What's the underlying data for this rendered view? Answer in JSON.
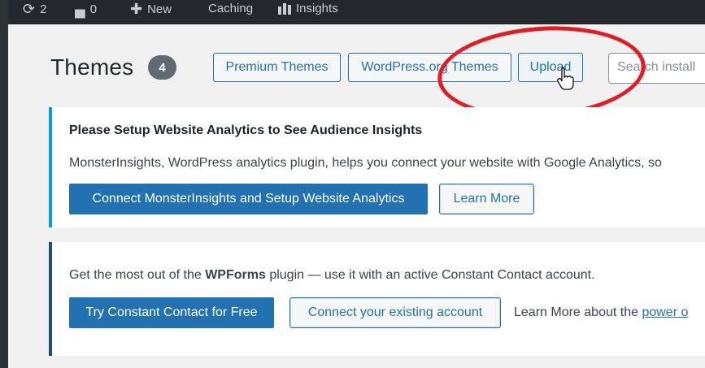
{
  "adminbar": {
    "updates_count": "2",
    "comments_count": "0",
    "new_label": "New",
    "caching_label": "Caching",
    "insights_label": "Insights"
  },
  "page": {
    "title": "Themes",
    "theme_count": "4"
  },
  "buttons": {
    "premium_themes": "Premium Themes",
    "wordpress_org_themes": "WordPress.org Themes",
    "upload": "Upload"
  },
  "search": {
    "placeholder": "Search install"
  },
  "notice_analytics": {
    "title": "Please Setup Website Analytics to See Audience Insights",
    "text": "MonsterInsights, WordPress analytics plugin, helps you connect your website with Google Analytics, so",
    "primary_button": "Connect MonsterInsights and Setup Website Analytics",
    "secondary_button": "Learn More"
  },
  "notice_wpforms": {
    "text_before": "Get the most out of the ",
    "text_bold": "WPForms",
    "text_after": " plugin — use it with an active Constant Contact account.",
    "primary_button": "Try Constant Contact for Free",
    "secondary_button": "Connect your existing account",
    "learn_more_text": "Learn More about the ",
    "learn_more_link": "power o"
  },
  "colors": {
    "accent": "#2271b1",
    "annotation_circle": "#e31b23",
    "adminbar": "#23282d"
  }
}
